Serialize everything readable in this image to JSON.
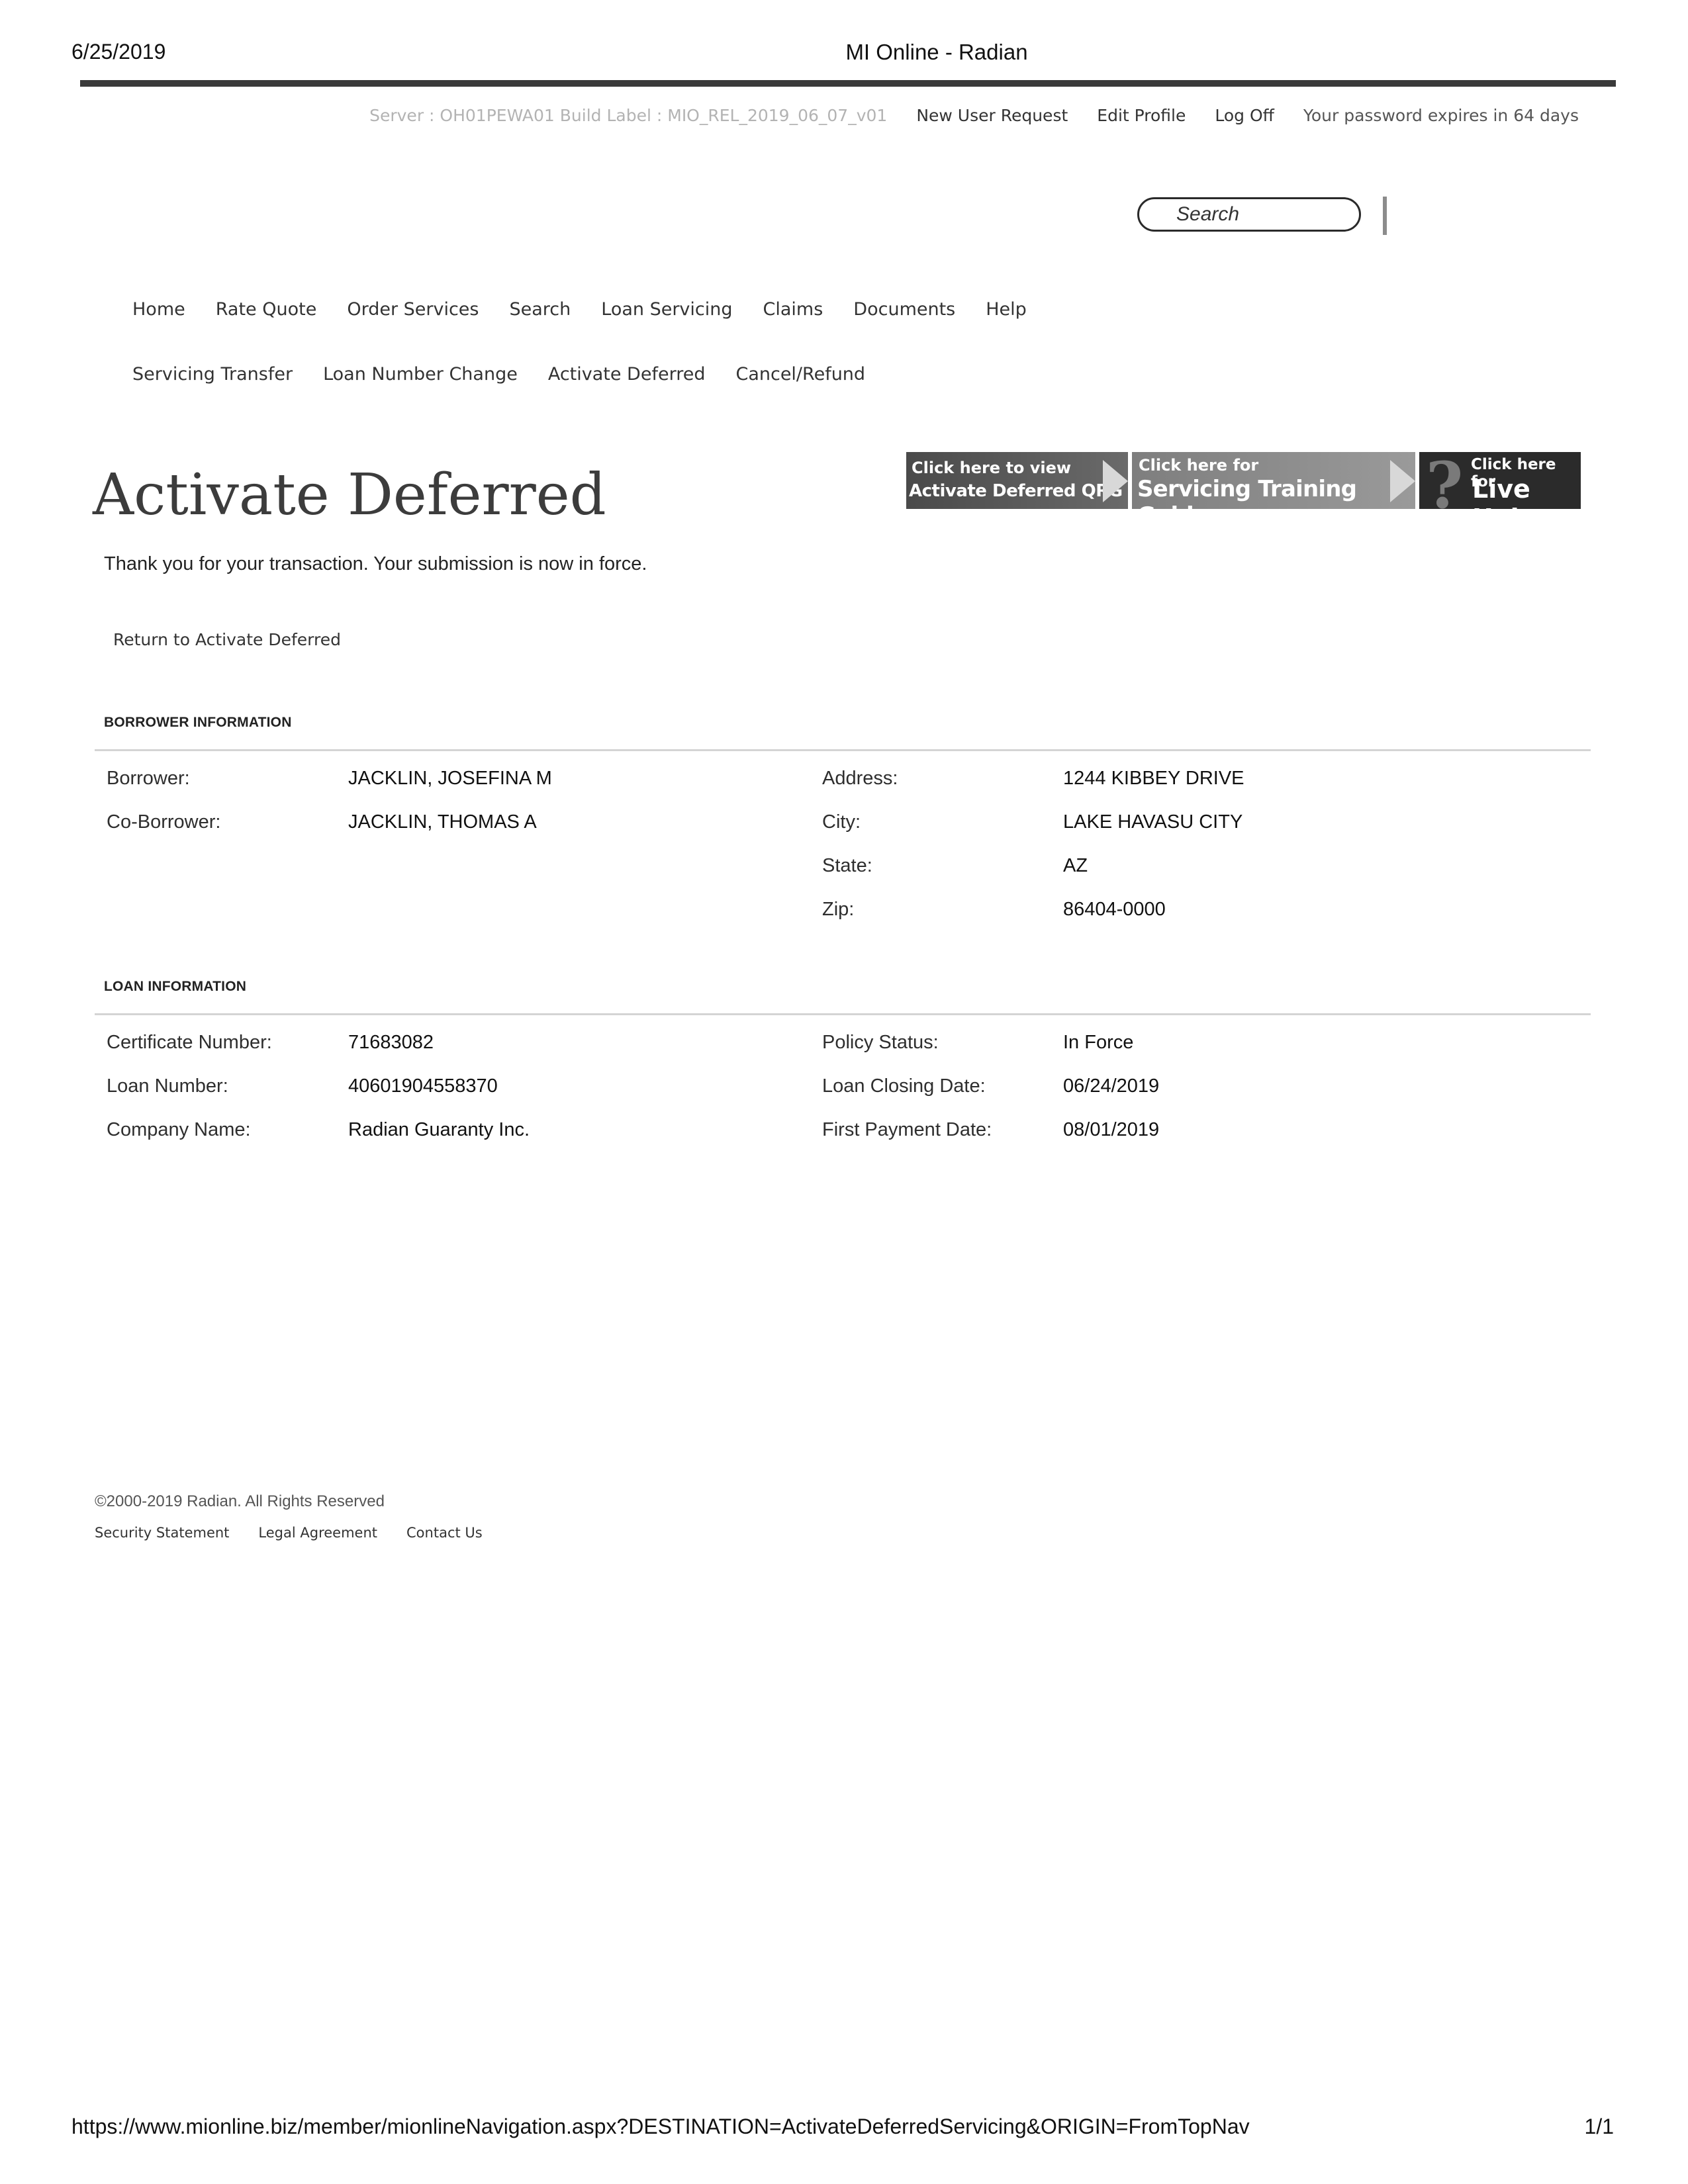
{
  "print": {
    "date": "6/25/2019",
    "title": "MI Online - Radian",
    "url": "https://www.mionline.biz/member/mionlineNavigation.aspx?DESTINATION=ActivateDeferredServicing&ORIGIN=FromTopNav",
    "page": "1/1"
  },
  "utility": {
    "server": "Server : OH01PEWA01 Build Label : MIO_REL_2019_06_07_v01",
    "new_user": "New User Request",
    "edit_profile": "Edit Profile",
    "log_off": "Log Off",
    "password_note": "Your password expires in 64 days"
  },
  "search": {
    "placeholder": "Search"
  },
  "nav_main": [
    "Home",
    "Rate Quote",
    "Order Services",
    "Search",
    "Loan Servicing",
    "Claims",
    "Documents",
    "Help"
  ],
  "nav_sub": [
    "Servicing Transfer",
    "Loan Number Change",
    "Activate Deferred",
    "Cancel/Refund"
  ],
  "page_title": "Activate Deferred",
  "banners": {
    "qrg": {
      "line1": "Click here to view",
      "line2": "Activate Deferred QRG"
    },
    "guide": {
      "line1": "Click here for",
      "line2": "Servicing Training Guide"
    },
    "live": {
      "line1": "Click here for",
      "line2": "Live Help"
    }
  },
  "confirmation": "Thank you for your transaction. Your submission is now in force.",
  "return_link": "Return to Activate Deferred",
  "borrower": {
    "heading": "BORROWER INFORMATION",
    "borrower_label": "Borrower:",
    "borrower_value": "JACKLIN, JOSEFINA M",
    "coborrower_label": "Co-Borrower:",
    "coborrower_value": "JACKLIN, THOMAS A",
    "address_label": "Address:",
    "address_value": "1244 KIBBEY DRIVE",
    "city_label": "City:",
    "city_value": "LAKE HAVASU CITY",
    "state_label": "State:",
    "state_value": "AZ",
    "zip_label": "Zip:",
    "zip_value": "86404-0000"
  },
  "loan": {
    "heading": "LOAN INFORMATION",
    "cert_label": "Certificate Number:",
    "cert_value": "71683082",
    "loan_label": "Loan Number:",
    "loan_value": "40601904558370",
    "company_label": "Company Name:",
    "company_value": "Radian Guaranty Inc.",
    "status_label": "Policy Status:",
    "status_value": "In Force",
    "closing_label": "Loan Closing Date:",
    "closing_value": "06/24/2019",
    "payment_label": "First Payment Date:",
    "payment_value": "08/01/2019"
  },
  "footer": {
    "copyright": "©2000-2019 Radian. All Rights Reserved",
    "links": [
      "Security Statement",
      "Legal Agreement",
      "Contact Us"
    ]
  }
}
